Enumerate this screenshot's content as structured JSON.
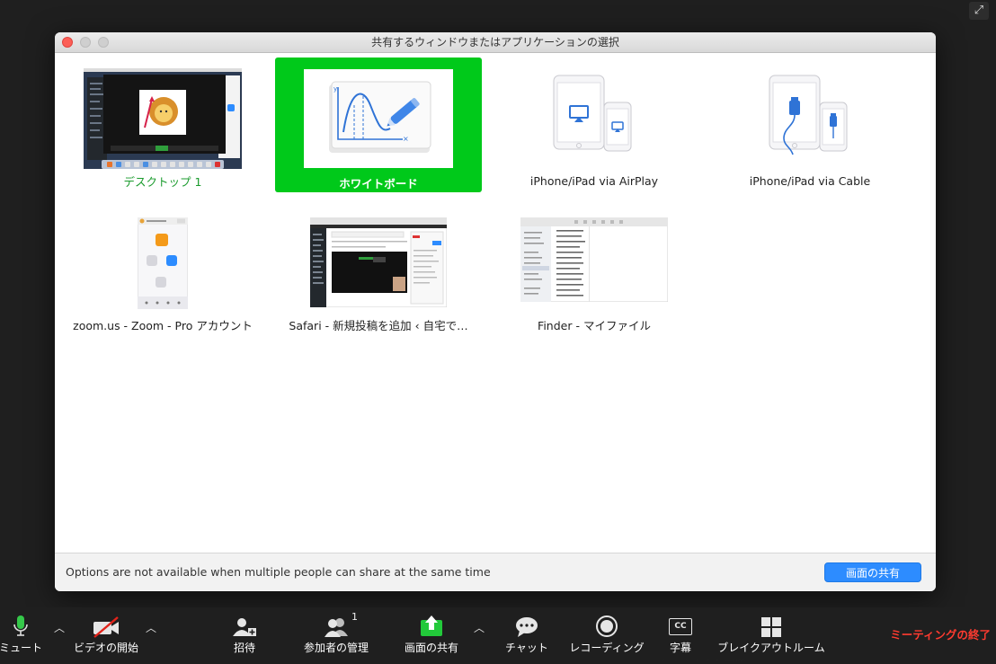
{
  "dialog": {
    "title": "共有するウィンドウまたはアプリケーションの選択",
    "footer_message": "Options are not available when multiple people can share at the same time",
    "share_button": "画面の共有"
  },
  "tiles": [
    {
      "label": "デスクトップ 1",
      "state": "normal"
    },
    {
      "label": "ホワイトボード",
      "state": "selected"
    },
    {
      "label": "iPhone/iPad via AirPlay",
      "state": "normal"
    },
    {
      "label": "iPhone/iPad via Cable",
      "state": "normal"
    },
    {
      "label": "zoom.us - Zoom - Pro アカウント",
      "state": "normal"
    },
    {
      "label": "Safari - 新規投稿を追加 ‹ 自宅で…",
      "state": "normal"
    },
    {
      "label": "Finder - マイファイル",
      "state": "normal"
    }
  ],
  "toolbar": {
    "mute": "ミュート",
    "video": "ビデオの開始",
    "invite": "招待",
    "participants": "参加者の管理",
    "participants_count": "1",
    "share": "画面の共有",
    "chat": "チャット",
    "record": "レコーディング",
    "cc": "字幕",
    "cc_glyph": "CC",
    "breakout": "ブレイクアウトルーム",
    "end": "ミーティングの終了"
  },
  "background_text": "アイキャッチ画像",
  "colors": {
    "selected_green": "#00c91a",
    "share_blue": "#2d8cff",
    "end_red": "#ff3b30",
    "share_icon_green": "#22c93a"
  }
}
